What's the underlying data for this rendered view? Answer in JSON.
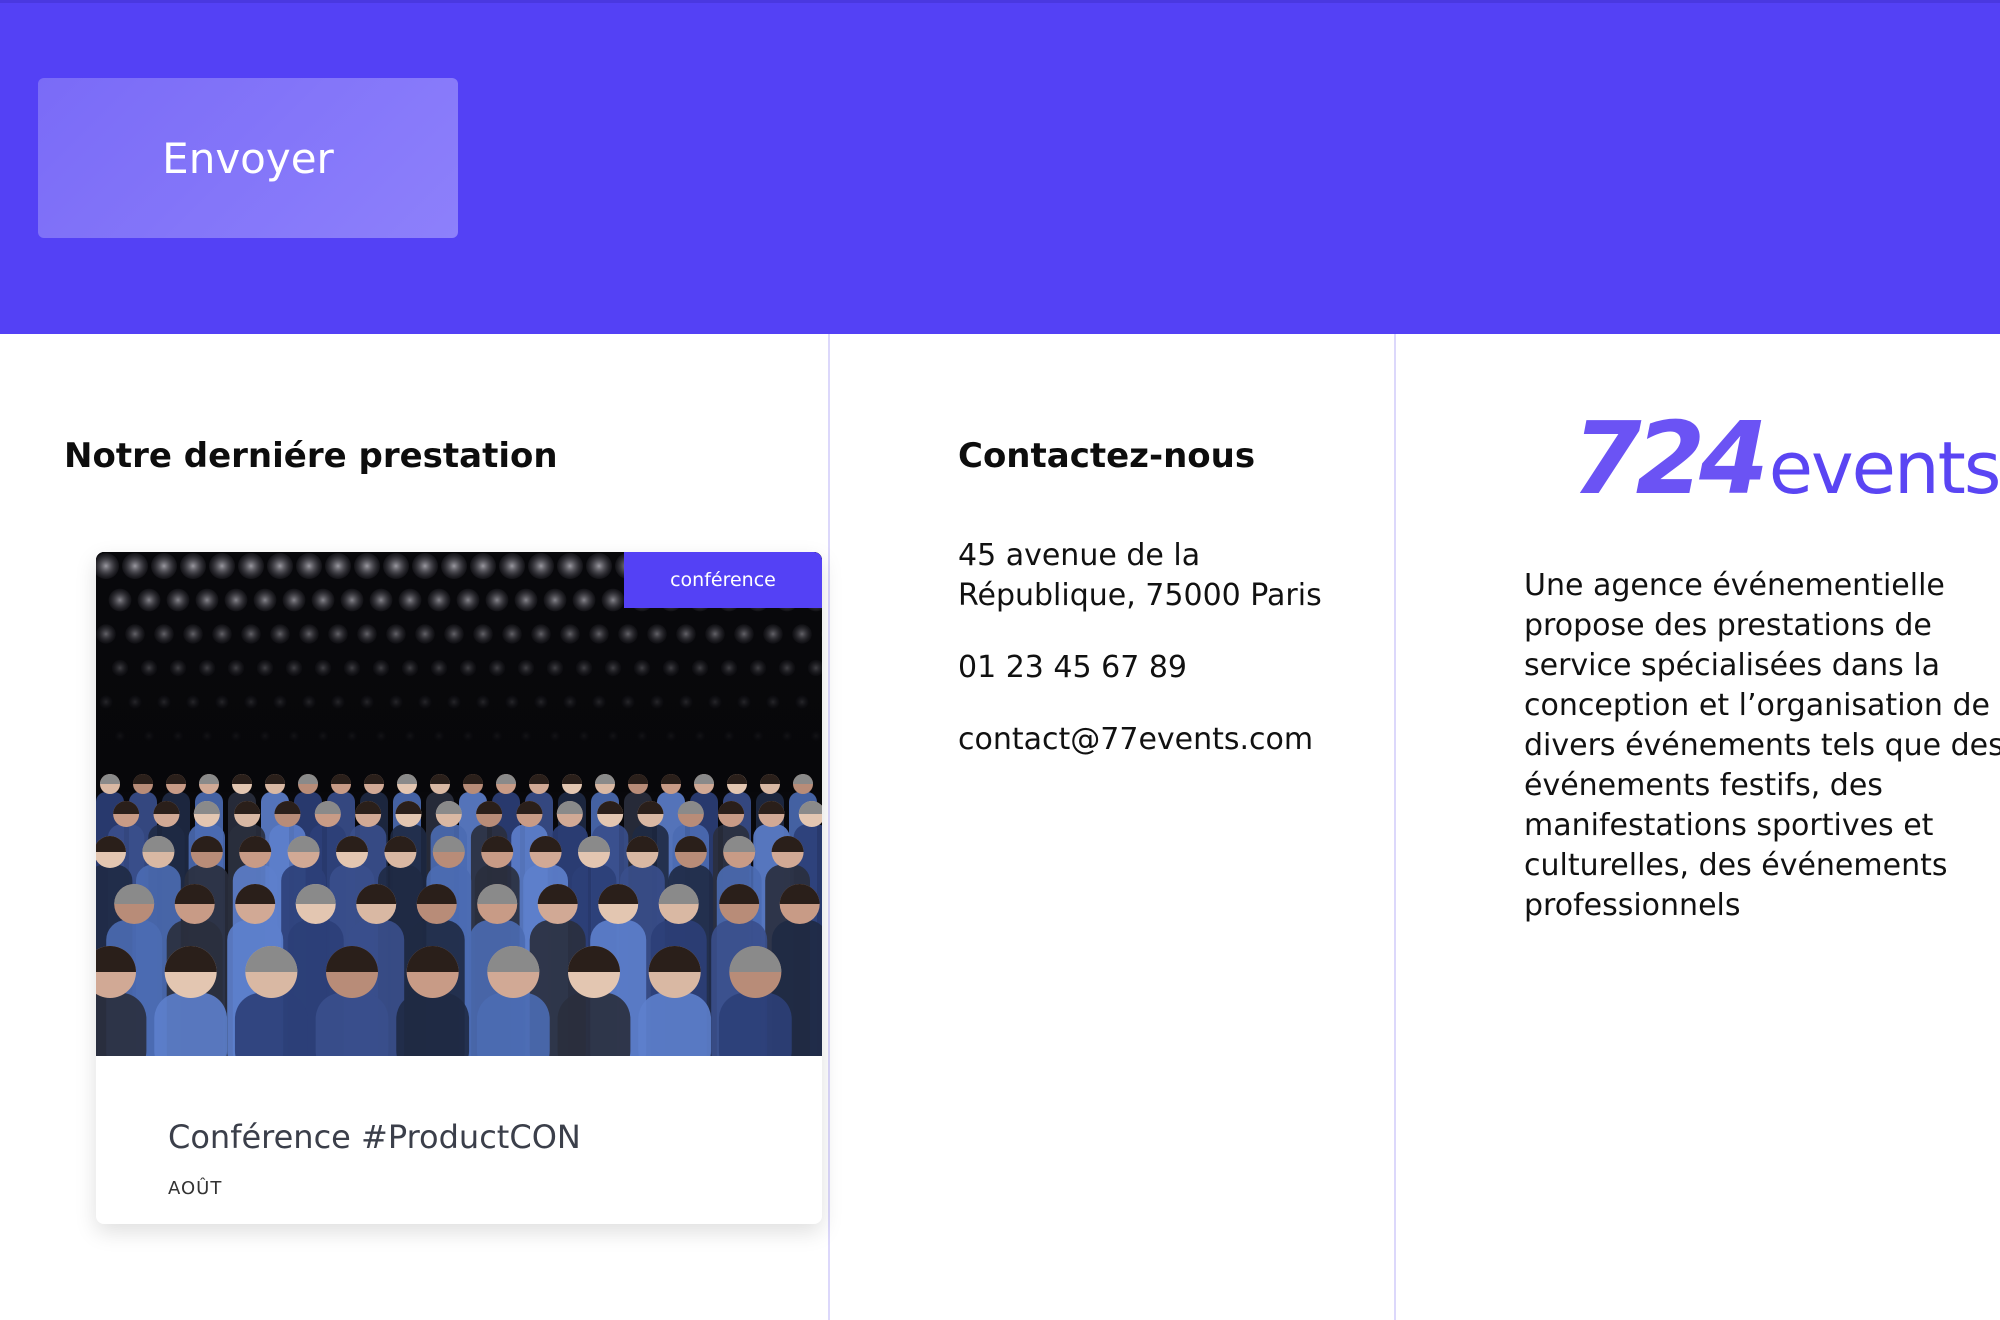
{
  "form": {
    "send_label": "Envoyer"
  },
  "footer": {
    "latest": {
      "heading": "Notre derniére prestation",
      "card": {
        "badge": "conférence",
        "title": "Conférence #ProductCON",
        "date": "AOÛT",
        "image": "conference-audience-photo"
      }
    },
    "contact": {
      "heading": "Contactez-nous",
      "address_line1": "45 avenue de la",
      "address_line2": "République, 75000 Paris",
      "phone": "01 23 45 67 89",
      "email": "contact@77events.com"
    },
    "brand": {
      "logo_number": "724",
      "logo_word": "events",
      "description_lines": [
        "Une agence événementielle",
        "propose des prestations de",
        "service spécialisées dans la",
        "conception et l’organisation de",
        "divers événements tels que des",
        "événements festifs, des",
        "manifestations sportives et",
        "culturelles, des événements",
        "professionnels"
      ]
    }
  },
  "colors": {
    "accent": "#5441f5",
    "divider": "#dcd8fb",
    "text": "#111111"
  }
}
